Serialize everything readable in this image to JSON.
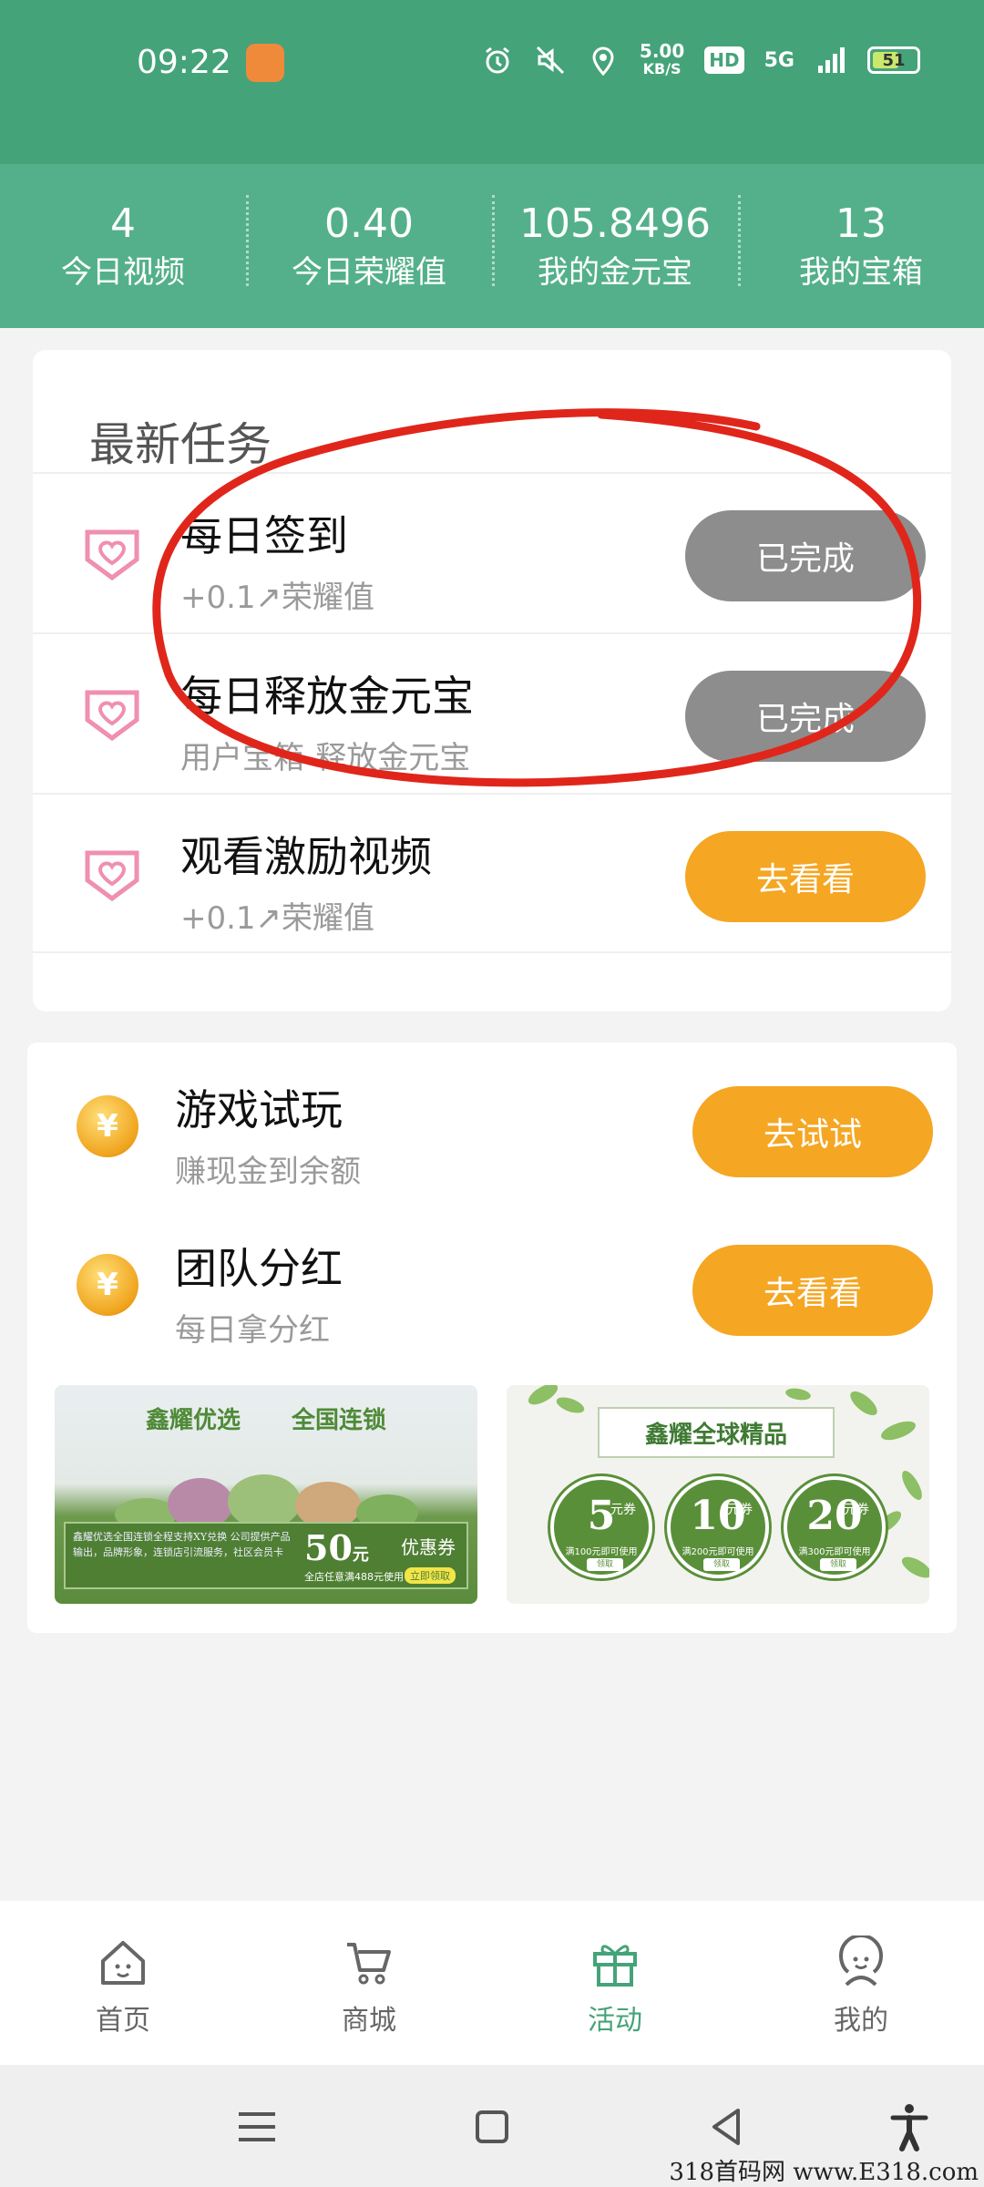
{
  "status_bar": {
    "time": "09:22",
    "speed_value": "5.00",
    "speed_unit": "KB/S",
    "hd": "HD",
    "network": "5G",
    "battery": "51"
  },
  "stats": [
    {
      "value": "4",
      "label": "今日视频"
    },
    {
      "value": "0.40",
      "label": "今日荣耀值"
    },
    {
      "value": "105.8496",
      "label": "我的金元宝"
    },
    {
      "value": "13",
      "label": "我的宝箱"
    }
  ],
  "tasks": {
    "section_title": "最新任务",
    "items": [
      {
        "title": "每日签到",
        "subtitle": "+0.1↗荣耀值",
        "button": "已完成",
        "state": "done"
      },
      {
        "title": "每日释放金元宝",
        "subtitle": "用户宝箱-释放金元宝",
        "button": "已完成",
        "state": "done"
      },
      {
        "title": "观看激励视频",
        "subtitle": "+0.1↗荣耀值",
        "button": "去看看",
        "state": "todo"
      }
    ]
  },
  "games": [
    {
      "title": "游戏试玩",
      "subtitle": "赚现金到余额",
      "button": "去试试",
      "icon": "yen-coin-icon"
    },
    {
      "title": "团队分红",
      "subtitle": "每日拿分红",
      "button": "去看看",
      "icon": "yen-coin-icon"
    }
  ],
  "banner_left": {
    "heading_1": "鑫耀优选",
    "heading_2": "全国连锁",
    "description": "鑫耀优选全国连锁全程支持XY兑换 公司提供产品输出，品牌形象，连锁店引流服务，社区会员卡",
    "amount": "50",
    "amount_unit": "元",
    "coupon_label": "优惠券",
    "condition": "全店任意满488元使用",
    "claim": "立即领取"
  },
  "banner_right": {
    "title": "鑫耀全球精品",
    "vouchers": [
      {
        "amount": "5",
        "unit": "元券",
        "condition": "满100元即可使用",
        "button": "领取"
      },
      {
        "amount": "10",
        "unit": "元券",
        "condition": "满200元即可使用",
        "button": "领取"
      },
      {
        "amount": "20",
        "unit": "元券",
        "condition": "满300元即可使用",
        "button": "领取"
      }
    ]
  },
  "bottom_nav": [
    {
      "label": "首页",
      "icon": "home-icon",
      "active": false
    },
    {
      "label": "商城",
      "icon": "cart-icon",
      "active": false
    },
    {
      "label": "活动",
      "icon": "gift-icon",
      "active": true
    },
    {
      "label": "我的",
      "icon": "profile-icon",
      "active": false
    }
  ],
  "watermark": "318首码网 www.E318.com",
  "colors": {
    "header": "#45a379",
    "stats_bar": "#54b08b",
    "done_button": "#8d8d8d",
    "action_button": "#f5a623",
    "nav_active": "#45a379",
    "annotation": "#e0261b"
  }
}
